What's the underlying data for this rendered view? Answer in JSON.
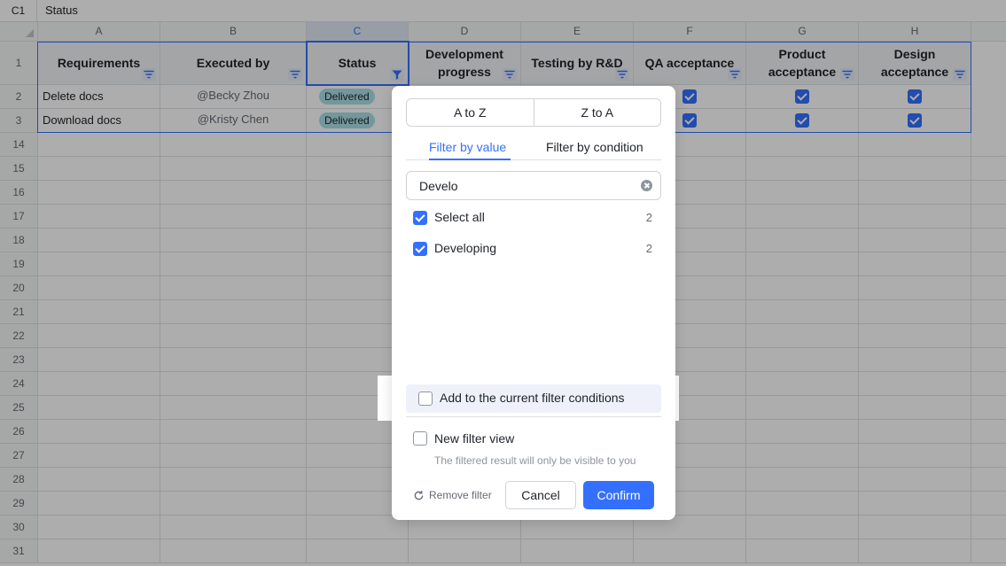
{
  "formula_bar": {
    "cell_ref": "C1",
    "value": "Status"
  },
  "columns": [
    "A",
    "B",
    "C",
    "D",
    "E",
    "F",
    "G",
    "H"
  ],
  "rows": [
    "1",
    "2",
    "3",
    "14",
    "15",
    "16",
    "17",
    "18",
    "19",
    "20",
    "21",
    "22",
    "23",
    "24",
    "25",
    "26",
    "27",
    "28",
    "29",
    "30",
    "31"
  ],
  "header_row": {
    "requirements": "Requirements",
    "executed_by": "Executed by",
    "status": "Status",
    "development_progress": "Development progress",
    "testing_by_rd": "Testing by R&D",
    "qa_acceptance": "QA acceptance",
    "product_acceptance": "Product acceptance",
    "design_acceptance": "Design acceptance"
  },
  "data_rows": [
    {
      "requirement": "Delete docs",
      "executed_by": "@Becky Zhou",
      "status": "Delivered",
      "qa": true,
      "product": true,
      "design": true
    },
    {
      "requirement": "Download docs",
      "executed_by": "@Kristy Chen",
      "status": "Delivered",
      "qa": true,
      "product": true,
      "design": true
    }
  ],
  "filter_panel": {
    "sort_asc": "A to Z",
    "sort_desc": "Z to A",
    "tab_value": "Filter by value",
    "tab_condition": "Filter by condition",
    "active_tab": "Filter by value",
    "search_value": "Develo",
    "options": [
      {
        "label": "Select all",
        "count": "2",
        "checked": true
      },
      {
        "label": "Developing",
        "count": "2",
        "checked": true
      }
    ],
    "add_condition_label": "Add to the current filter conditions",
    "add_condition_checked": false,
    "new_view_label": "New filter view",
    "new_view_checked": false,
    "hint": "The filtered result will only be visible to you",
    "remove_filter": "Remove filter",
    "cancel": "Cancel",
    "confirm": "Confirm"
  },
  "colors": {
    "accent": "#3370ff",
    "badge": "#a9dfe8",
    "header_bg": "#f2f3f5"
  },
  "icons": [
    "filter-icon",
    "clear-icon",
    "refresh-icon"
  ]
}
